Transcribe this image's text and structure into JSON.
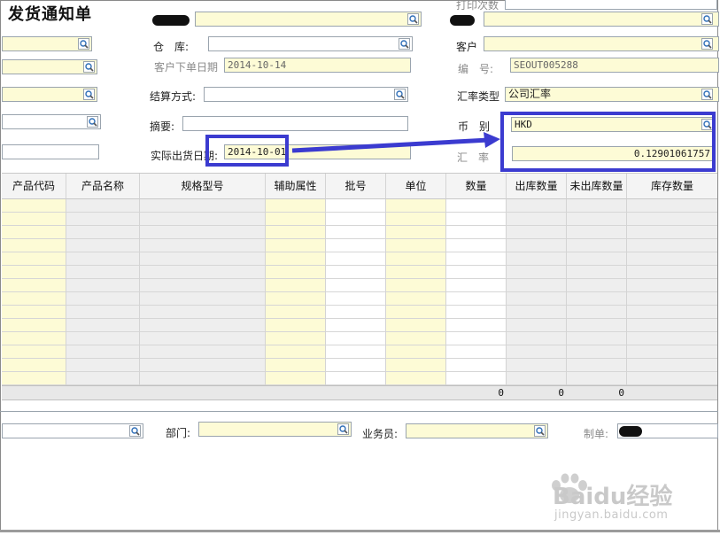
{
  "form": {
    "title": "发货通知单",
    "print_count_label": "打印次数",
    "warehouse_label": "仓　库:",
    "customer_order_date_label": "客户下单日期",
    "customer_order_date_value": "2014-10-14",
    "settlement_label": "结算方式:",
    "summary_label": "摘要:",
    "actual_ship_date_label": "实际出货日期:",
    "actual_ship_date_value": "2014-10-01",
    "customer_label": "客户",
    "number_label": "编　号:",
    "number_value": "SEOUT005288",
    "rate_type_label": "汇率类型",
    "rate_type_value": "公司汇率",
    "currency_label": "币　别",
    "currency_value": "HKD",
    "rate_label": "汇　率",
    "rate_value": "0.12901061757"
  },
  "grid": {
    "columns": [
      "产品代码",
      "产品名称",
      "规格型号",
      "辅助属性",
      "批号",
      "单位",
      "数量",
      "出库数量",
      "未出库数量",
      "库存数量"
    ],
    "totals": {
      "quantity": "0",
      "out_quantity": "0",
      "not_out_quantity": "0"
    }
  },
  "footer": {
    "department_label": "部门:",
    "salesperson_label": "业务员:",
    "maker_label": "制单:"
  },
  "watermark": {
    "brand": "Baidu经验",
    "url": "jingyan.baidu.com"
  },
  "colors": {
    "highlight": "#3b3bd0",
    "field_yellow": "#fdfbd6"
  }
}
